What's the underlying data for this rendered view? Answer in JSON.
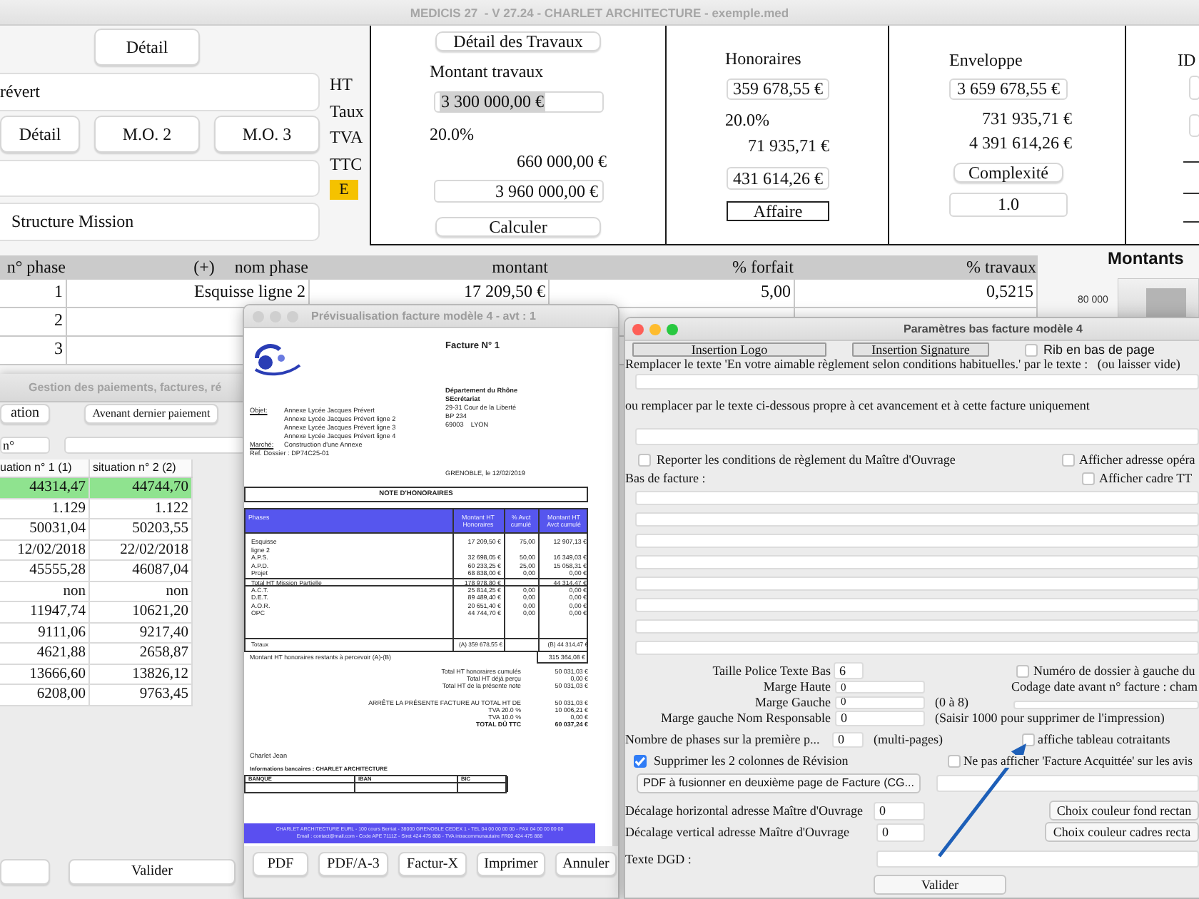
{
  "app_window": {
    "title": "MEDICIS 27  - V 27.24 - CHARLET ARCHITECTURE - exemple.med"
  },
  "project_form": {
    "detail_button": "Détail",
    "client_field": "révert",
    "buttons": [
      "Détail",
      "M.O. 2",
      "M.O. 3"
    ],
    "mission_field": "Structure Mission"
  },
  "amount_labels": [
    "HT",
    "Taux",
    "TVA",
    "TTC"
  ],
  "badge": "E",
  "works_panel": {
    "button": "Détail des Travaux",
    "title": "Montant travaux",
    "ht": "3 300 000,00 €",
    "ht_selected": true,
    "rate": "20.0%",
    "tva": "660 000,00 €",
    "ttc": "3 960 000,00 €",
    "action": "Calculer"
  },
  "fees_panel": {
    "title": "Honoraires",
    "ht": "359 678,55 €",
    "rate": "20.0%",
    "tva": "71 935,71 €",
    "ttc": "431 614,26 €",
    "action": "Affaire"
  },
  "envelope_panel": {
    "title": "Enveloppe",
    "ht": "3 659 678,55 €",
    "tva": "731 935,71 €",
    "ttc": "4 391 614,26 €",
    "action": "Complexité",
    "complexity": "1.0"
  },
  "column_panel_4": {
    "title": "ID"
  },
  "phase_table": {
    "columns": [
      "n° phase",
      "nom phase",
      "montant",
      "% forfait",
      "% travaux"
    ],
    "add_label": "(+)",
    "rows": [
      {
        "number": "1",
        "name": "Esquisse ligne 2",
        "amount": "17 209,50 €",
        "forfait": "5,00",
        "travaux": "0,5215"
      },
      {
        "number": "2"
      },
      {
        "number": "3"
      }
    ]
  },
  "amounts_chart": {
    "title": "Montants",
    "tick": "80 000"
  },
  "payments_window": {
    "title": "Gestion des paiements, factures, ré",
    "buttons": [
      "ation",
      "Avenant dernier paiement"
    ],
    "number_field": "n°",
    "columns": [
      "uation n° 1 (1)",
      "situation n° 2 (2)"
    ],
    "rows": [
      {
        "values": [
          "44314,47",
          "44744,70"
        ],
        "selected": true
      },
      {
        "values": [
          "1.129",
          "1.122"
        ],
        "selected": false
      },
      {
        "values": [
          "50031,04",
          "50203,55"
        ],
        "selected": false
      },
      {
        "values": [
          "12/02/2018",
          "22/02/2018"
        ],
        "selected": false
      },
      {
        "values": [
          "45555,28",
          "46087,04"
        ],
        "selected": false
      },
      {
        "values": [
          "non",
          "non"
        ],
        "selected": false
      },
      {
        "values": [
          "11947,74",
          "10621,20"
        ],
        "selected": false
      },
      {
        "values": [
          "9111,06",
          "9217,40"
        ],
        "selected": false
      },
      {
        "values": [
          "4621,88",
          "2658,87"
        ],
        "selected": false
      },
      {
        "values": [
          "13666,60",
          "13826,12"
        ],
        "selected": false
      },
      {
        "values": [
          "6208,00",
          "9763,45"
        ],
        "selected": false
      }
    ],
    "submit": "Valider"
  },
  "preview_window": {
    "title": "Prévisualisation facture modèle 4 - avt : 1",
    "invoice": {
      "number": "Facture N° 1",
      "recipient": {
        "name": "Département du Rhône",
        "service": "SEcrétariat",
        "address": [
          "29-31 Cour de la Liberté",
          "BP 234",
          "69003    LYON"
        ]
      },
      "object_label": "Objet:",
      "object_lines": [
        "Annexe Lycée Jacques Prévert",
        "Annexe Lycée Jacques Prévert ligne 2",
        "Annexe Lycée Jacques Prévert ligne 3",
        "Annexe Lycée Jacques Prévert ligne 4"
      ],
      "market_label": "Marché:",
      "market": "Construction d'une Annexe",
      "reference": "Ref. Dossier : DP74C25-01",
      "place_date": "GRENOBLE, le 12/02/2019",
      "heading": "NOTE D'HONORAIRES",
      "columns": [
        "Phases",
        "Montant HT Honoraires",
        "% Avct cumulé",
        "Montant HT Avct cumulé"
      ],
      "rows": [
        {
          "kind": "phase",
          "phase": "Esquisse",
          "amount": "17 209,50 €",
          "percent": "75,00",
          "progress": "12 907,13 €"
        },
        {
          "kind": "phase",
          "phase": "ligne 2"
        },
        {
          "kind": "phase",
          "phase": "A.P.S.",
          "amount": "32 698,05 €",
          "percent": "50,00",
          "progress": "16 349,03 €"
        },
        {
          "kind": "phase",
          "phase": "A.P.D.",
          "amount": "60 233,25 €",
          "percent": "25,00",
          "progress": "15 058,31 €"
        },
        {
          "kind": "phase",
          "phase": "Projet",
          "amount": "68 838,00 €",
          "percent": "0,00",
          "progress": "0,00 €"
        },
        {
          "kind": "subtotal",
          "phase": "Total HT Mission Partielle",
          "amount": "178 978,80 €",
          "progress": "44 314,47 €"
        },
        {
          "kind": "phase",
          "phase": "A.C.T.",
          "amount": "25 814,25 €",
          "percent": "0,00",
          "progress": "0,00 €"
        },
        {
          "kind": "phase",
          "phase": "D.E.T.",
          "amount": "89 489,40 €",
          "percent": "0,00",
          "progress": "0,00 €"
        },
        {
          "kind": "phase",
          "phase": "A.O.R.",
          "amount": "20 651,40 €",
          "percent": "0,00",
          "progress": "0,00 €"
        },
        {
          "kind": "phase",
          "phase": "OPC",
          "amount": "44 744,70 €",
          "percent": "0,00",
          "progress": "0,00 €"
        }
      ],
      "totals": {
        "label": "Totaux",
        "amount": "(A) 359 678,55 €",
        "progress": "(B) 44 314,47 €"
      },
      "remaining": {
        "label": "Montant HT honoraires restants à percevoir (A)-(B)",
        "value": "315 364,08 €"
      },
      "summary": [
        {
          "label": "Total HT honoraires cumulés",
          "value": "50 031,03 €"
        },
        {
          "label": "Total HT déjà perçu",
          "value": "0,00 €"
        },
        {
          "label": "Total HT de la présente note",
          "value": "50 031,03 €"
        }
      ],
      "closing": [
        {
          "kind": "line",
          "label": "ARRÊTE LA PRÉSENTE FACTURE AU TOTAL HT DE",
          "value": "50 031,03 €"
        },
        {
          "kind": "line",
          "label": "TVA 20.0 %",
          "value": "10 006,21 €"
        },
        {
          "kind": "line",
          "label": "TVA 10.0 %",
          "value": "0,00 €"
        },
        {
          "kind": "total",
          "label": "TOTAL DÛ TTC",
          "value": "60 037,24 €"
        }
      ],
      "signatory": "Charlet Jean",
      "bank_title": "Informations bancaires : CHARLET ARCHITECTURE",
      "bank_columns": [
        "BANQUE",
        "IBAN",
        "BIC"
      ],
      "footer": [
        "CHARLET ARCHITECTURE EURL - 100 cours Berriat - 38000 GRENOBLE CEDEX 1 - TEL 04 00 00 00 00 - FAX 04 00 00 00 00",
        "Email : contact@mail.com - Code APE 7111Z - Siret 424 475 888 - TVA intracommunautaire FR00 424 475 888"
      ]
    },
    "buttons": [
      "PDF",
      "PDF/A-3",
      "Factur-X",
      "Imprimer",
      "Annuler"
    ]
  },
  "params_window": {
    "title": "Paramètres bas facture modèle 4",
    "top_buttons": [
      "Insertion Logo",
      "Insertion Signature"
    ],
    "rib": {
      "label": "Rib en bas de page",
      "checked": false
    },
    "replace_label": "Remplacer le texte 'En votre aimable règlement selon conditions habituelles.' par le texte :   (ou laisser vide)",
    "replace_below_label": "ou remplacer par le texte ci-dessous propre à cet avancement et à cette facture uniquement",
    "conditions": {
      "label": "Reporter les conditions de règlement du Maître d'Ouvrage",
      "checked": false
    },
    "show_address": {
      "label": "Afficher adresse opéra",
      "checked": false
    },
    "footer_label": "Bas de facture :",
    "show_frame": {
      "label": "Afficher cadre TT",
      "checked": false
    },
    "font_size": {
      "label": "Taille Police Texte Bas",
      "value": "6"
    },
    "folder_number": {
      "label": "Numéro de dossier à gauche du",
      "checked": false
    },
    "top_margin": {
      "label": "Marge Haute",
      "value": "0"
    },
    "date_code_label": "Codage date avant n° facture : cham",
    "left_margin": {
      "label": "Marge Gauche",
      "value": "0",
      "note": "(0 à 8)"
    },
    "responsible_margin": {
      "label": "Marge gauche Nom Responsable",
      "value": "0",
      "note": "(Saisir 1000 pour supprimer de l'impression)"
    },
    "phases_first_page": {
      "label": "Nombre de phases sur la première p...",
      "value": "0",
      "note": "(multi-pages)"
    },
    "cotraitants": {
      "label": "affiche tableau cotraitants",
      "checked": false
    },
    "revision": {
      "label": "Supprimer les 2 colonnes de Révision",
      "checked": true
    },
    "acquittee": {
      "label": "Ne pas afficher 'Facture Acquittée' sur les avis",
      "checked": false
    },
    "merge_button": "PDF à fusionner en deuxième page de Facture (CG...",
    "offsets": [
      {
        "label": "Décalage horizontal adresse Maître d'Ouvrage",
        "value": "0",
        "button": "Choix couleur fond rectan"
      },
      {
        "label": "Décalage vertical adresse Maître d'Ouvrage",
        "value": "0",
        "button": "Choix couleur cadres recta"
      }
    ],
    "dgd_label": "Texte DGD :",
    "submit": "Valider"
  }
}
